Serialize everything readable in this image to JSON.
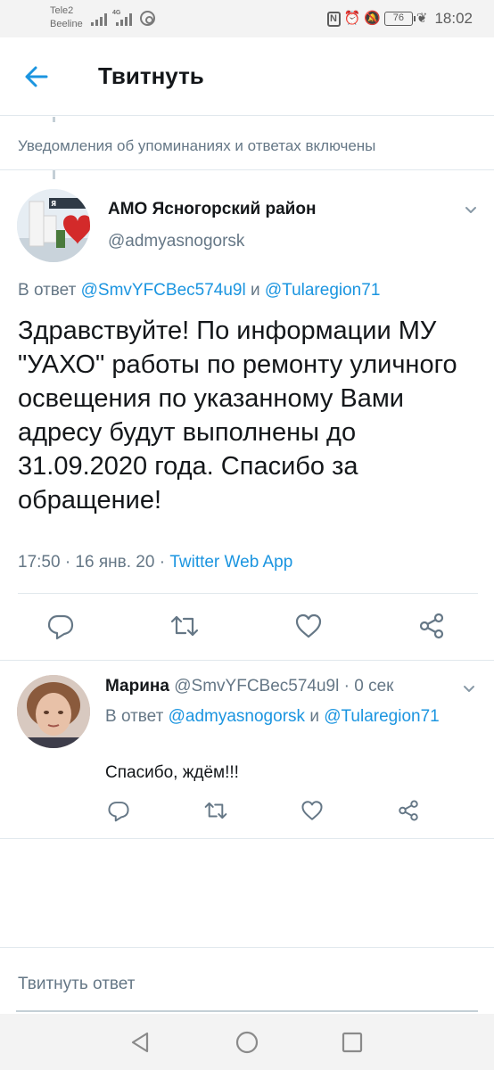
{
  "status_bar": {
    "carrier_1": "Tele2",
    "carrier_2": "Beeline",
    "network_type": "4G",
    "battery": "76",
    "time": "18:02"
  },
  "header": {
    "title": "Твитнуть",
    "back_icon": "arrow-left-icon"
  },
  "notice": {
    "text": "Уведомления об упоминаниях и ответах включены"
  },
  "main_tweet": {
    "author_name": "АМО Ясногорский район",
    "author_handle": "@admyasnogorsk",
    "reply_prefix": "В ответ",
    "reply_mention_1": "@SmvYFCBec574u9l",
    "reply_and": "и",
    "reply_mention_2": "@Tularegion71",
    "text": "Здравствуйте! По информации МУ \"УАХО\" работы по ремонту уличного освещения по указанному Вами адресу будут выполнены до 31.09.2020 года. Спасибо за обращение!",
    "timestamp": "17:50 · 16 янв. 20 ·",
    "source": "Twitter Web App"
  },
  "reply_tweet": {
    "author_name": "Марина",
    "author_handle": "@SmvYFCBec574u9l · 0 сек",
    "reply_prefix": "В ответ",
    "reply_mention_1": "@admyasnogorsk",
    "reply_and": "и",
    "reply_mention_2": "@Tularegion71",
    "text": "Спасибо, ждём!!!"
  },
  "actions": [
    "reply-icon",
    "retweet-icon",
    "like-icon",
    "share-icon"
  ],
  "compose": {
    "placeholder": "Твитнуть ответ"
  },
  "nav": [
    "back-triangle-icon",
    "home-circle-icon",
    "recents-square-icon"
  ],
  "colors": {
    "accent": "#1b95e0",
    "secondary_text": "#657786",
    "divider": "#e1e8ed"
  }
}
